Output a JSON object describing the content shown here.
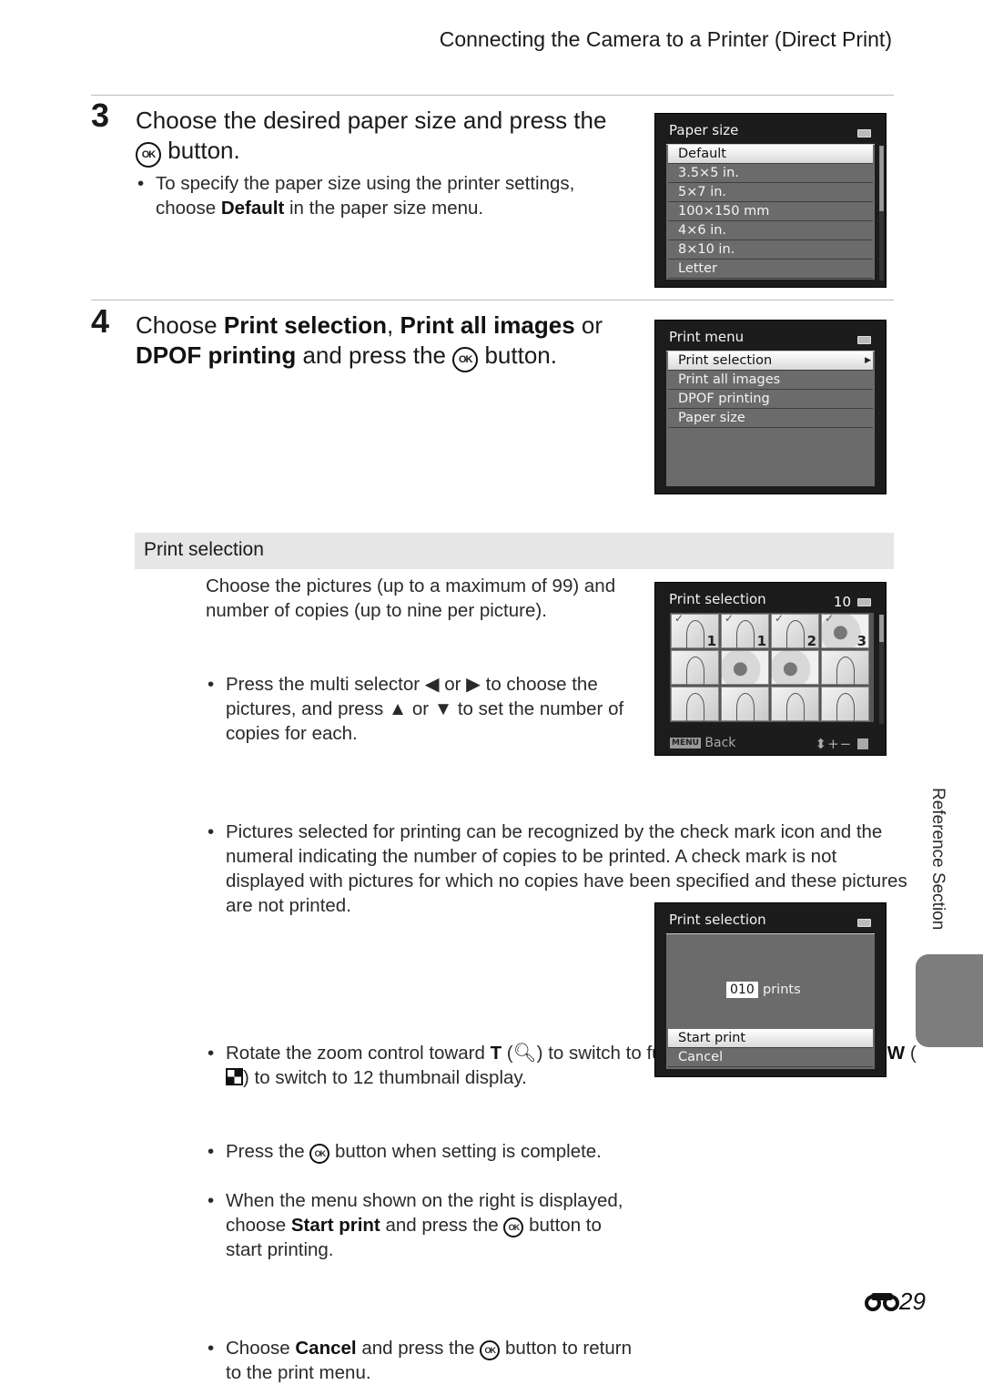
{
  "header": {
    "title": "Connecting the Camera to a Printer (Direct Print)"
  },
  "step3": {
    "number": "3",
    "heading_before": "Choose the desired paper size and press the",
    "heading_after": "button.",
    "ok_label": "OK",
    "bullet_before": "To specify the paper size using the printer settings, choose",
    "bullet_bold": "Default",
    "bullet_after": "in the paper size menu."
  },
  "paper_size_screen": {
    "title": "Paper size",
    "selected_index": 0,
    "items": [
      "Default",
      "3.5×5 in.",
      "5×7 in.",
      "100×150 mm",
      "4×6 in.",
      "8×10 in.",
      "Letter"
    ]
  },
  "step4": {
    "number": "4",
    "t1": "Choose",
    "b1": "Print selection",
    "t2": ",",
    "b2": "Print all images",
    "t3": "or",
    "b3": "DPOF printing",
    "t4": "and press the",
    "t5": "button.",
    "ok_label": "OK"
  },
  "print_menu_screen": {
    "title": "Print menu",
    "selected_index": 0,
    "items": [
      "Print selection",
      "Print all images",
      "DPOF printing",
      "Paper size"
    ]
  },
  "print_selection_section": {
    "title": "Print selection",
    "intro": "Choose the pictures (up to a maximum of 99) and number of copies (up to nine per picture).",
    "b1_a": "Press the multi selector",
    "b1_b": "or",
    "b1_c": "to choose the pictures, and press",
    "b1_d": "or",
    "b1_e": "to set the number of copies for each.",
    "b2": "Pictures selected for printing can be recognized by the check mark icon and the numeral indicating the number of copies to be printed. A check mark is not displayed with pictures for which no copies have been specified and these pictures are not printed.",
    "b3_a": "Rotate the zoom control toward",
    "b3_t": "T",
    "b3_b": "to switch to full-frame playback mode, or",
    "b3_w": "W",
    "b3_c": "to switch to 12 thumbnail display.",
    "b4_a": "Press the",
    "b4_b": "button when setting is complete.",
    "b5_a": "When the menu shown on the right is displayed, choose",
    "b5_bold": "Start print",
    "b5_b": "and press the",
    "b5_c": "button to start printing.",
    "b6_a": "Choose",
    "b6_bold": "Cancel",
    "b6_b": "and press the",
    "b6_c": "button to return to the print menu.",
    "ok_label": "OK"
  },
  "thumb_screen": {
    "title": "Print selection",
    "count": "10",
    "thumbnails": [
      {
        "type": "person",
        "checked": true,
        "copies": "1"
      },
      {
        "type": "person",
        "checked": true,
        "copies": "1"
      },
      {
        "type": "person",
        "checked": true,
        "copies": "2"
      },
      {
        "type": "flower",
        "checked": true,
        "copies": "3"
      },
      {
        "type": "person",
        "checked": false,
        "copies": ""
      },
      {
        "type": "flower",
        "checked": false,
        "copies": ""
      },
      {
        "type": "flower",
        "checked": false,
        "copies": ""
      },
      {
        "type": "person",
        "checked": false,
        "copies": ""
      },
      {
        "type": "person",
        "checked": false,
        "copies": ""
      },
      {
        "type": "person",
        "checked": false,
        "copies": ""
      },
      {
        "type": "person",
        "checked": false,
        "copies": ""
      },
      {
        "type": "person",
        "checked": false,
        "copies": ""
      }
    ],
    "menu_key": "MENU",
    "back_label": "Back",
    "controls": "⬍+−"
  },
  "confirm_screen": {
    "title": "Print selection",
    "prints_value": "010",
    "prints_label": "prints",
    "selected_index": 0,
    "items": [
      "Start print",
      "Cancel"
    ]
  },
  "side_tab": {
    "label": "Reference Section"
  },
  "page_number": "29"
}
